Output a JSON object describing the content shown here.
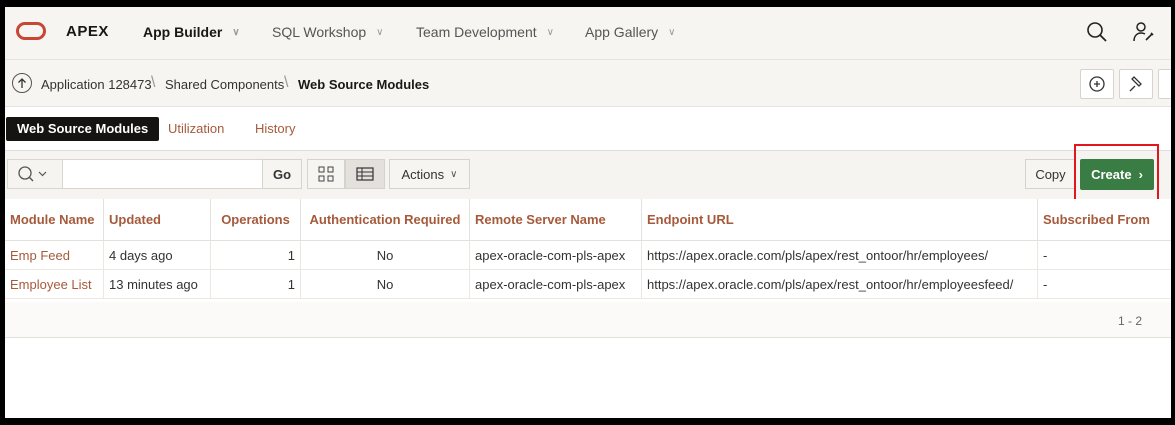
{
  "topbar": {
    "brand": "APEX",
    "nav": [
      {
        "label": "App Builder"
      },
      {
        "label": "SQL Workshop"
      },
      {
        "label": "Team Development"
      },
      {
        "label": "App Gallery"
      }
    ]
  },
  "breadcrumb": {
    "items": [
      "Application 128473",
      "Shared Components",
      "Web Source Modules"
    ]
  },
  "tabs": [
    "Web Source Modules",
    "Utilization",
    "History"
  ],
  "toolbar": {
    "search_value": "",
    "go_label": "Go",
    "actions_label": "Actions",
    "copy_label": "Copy",
    "create_label": "Create"
  },
  "table": {
    "columns": [
      "Module Name",
      "Updated",
      "Operations",
      "Authentication Required",
      "Remote Server Name",
      "Endpoint URL",
      "Subscribed From"
    ],
    "rows": [
      [
        "Emp Feed",
        "4 days ago",
        "1",
        "No",
        "apex-oracle-com-pls-apex",
        "https://apex.oracle.com/pls/apex/rest_ontoor/hr/employees/",
        "-"
      ],
      [
        "Employee List",
        "13 minutes ago",
        "1",
        "No",
        "apex-oracle-com-pls-apex",
        "https://apex.oracle.com/pls/apex/rest_ontoor/hr/employeesfeed/",
        "-"
      ]
    ],
    "pagination": "1 - 2"
  },
  "colors": {
    "accent": "#a65a3b",
    "brand_red": "#c74634",
    "create_green": "#3a7d44",
    "highlight_red": "#e1171d"
  },
  "icons": [
    "search-icon",
    "profile-wrench-icon",
    "arrow-up-circle-icon",
    "add-comment-icon",
    "pin-icon",
    "grid-view-icon",
    "table-view-icon",
    "chevron-down-icon",
    "chevron-right-icon"
  ]
}
